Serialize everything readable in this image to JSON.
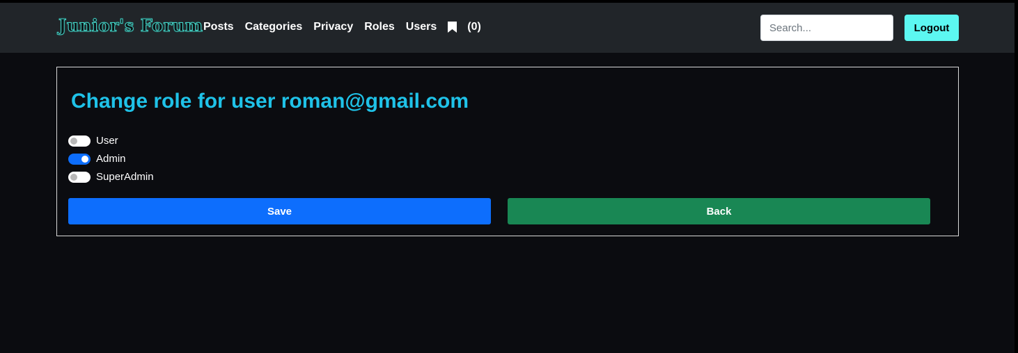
{
  "brand": {
    "name": "Junior's Forum"
  },
  "nav": {
    "links": [
      "Posts",
      "Categories",
      "Privacy",
      "Roles",
      "Users"
    ],
    "bookmark_icon": "bookmark-icon",
    "bookmark_count": "(0)"
  },
  "search": {
    "placeholder": "Search..."
  },
  "logout": {
    "label": "Logout"
  },
  "form": {
    "title": "Change role for user roman@gmail.com",
    "roles": [
      {
        "label": "User",
        "checked": false
      },
      {
        "label": "Admin",
        "checked": true
      },
      {
        "label": "SuperAdmin",
        "checked": false
      }
    ],
    "save_label": "Save",
    "back_label": "Back"
  },
  "colors": {
    "navbar": "#212529",
    "background": "#0b0c10",
    "title": "#1fc2e8",
    "save": "#0d6efd",
    "back": "#198754",
    "logout": "#5cf7f1"
  }
}
